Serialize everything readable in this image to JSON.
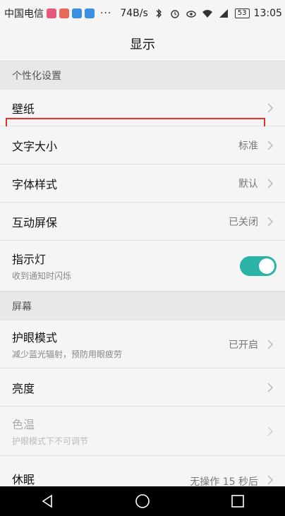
{
  "status_bar": {
    "carrier": "中国电信",
    "more": "···",
    "speed": "74B/s",
    "battery": "53",
    "time": "13:05",
    "app_icon_colors": [
      "#e55a7a",
      "#e86a5a",
      "#3a8fe0",
      "#3a8fe0"
    ]
  },
  "header": {
    "title": "显示"
  },
  "sections": {
    "personalization": {
      "label": "个性化设置",
      "wallpaper": {
        "title": "壁纸"
      },
      "text_size": {
        "title": "文字大小",
        "value": "标准"
      },
      "font_style": {
        "title": "字体样式",
        "value": "默认"
      },
      "screensaver": {
        "title": "互动屏保",
        "value": "已关闭"
      },
      "indicator": {
        "title": "指示灯",
        "subtitle": "收到通知时闪烁",
        "enabled": true
      }
    },
    "screen": {
      "label": "屏幕",
      "eye_mode": {
        "title": "护眼模式",
        "subtitle": "减少蓝光辐射，预防用眼疲劳",
        "value": "已开启"
      },
      "brightness": {
        "title": "亮度"
      },
      "color_temp": {
        "title": "色温",
        "subtitle": "护眼模式下不可调节"
      },
      "sleep": {
        "title": "休眠",
        "value": "无操作 15 秒后"
      }
    }
  },
  "colors": {
    "accent": "#2ab3a6",
    "highlight": "#e03030"
  }
}
